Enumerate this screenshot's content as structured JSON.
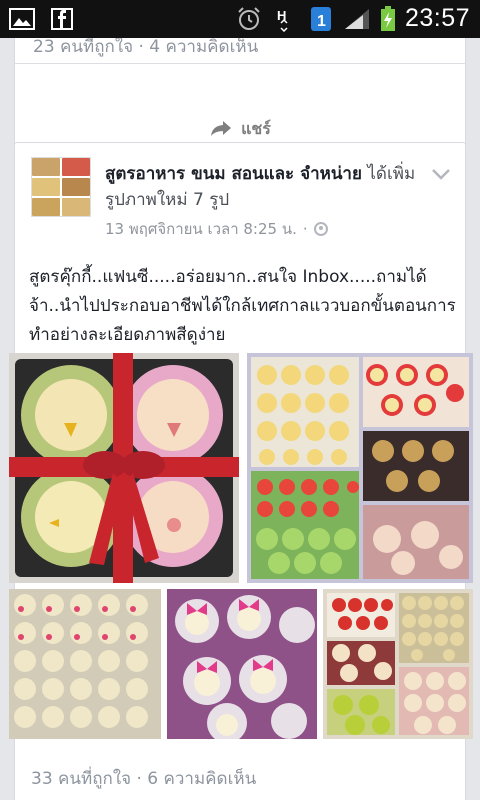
{
  "status_bar": {
    "time": "23:57",
    "network_badge": "1",
    "icons": [
      "image-notification-icon",
      "facebook-notification-icon",
      "alarm-icon",
      "hsdpa-icon",
      "sim-badge-icon",
      "signal-icon",
      "battery-charging-icon"
    ]
  },
  "previous_post": {
    "counts": "23 คนที่ถูกใจ · 4 ความคิดเห็น",
    "share_label": "แชร์"
  },
  "post": {
    "page_name": "สูตรอาหาร ขนม สอนและ จำหน่าย",
    "action": "ได้เพิ่มรูปภาพใหม่ 7 รูป",
    "timestamp": "13 พฤศจิกายน เวลา 8:25 น.",
    "separator": "·",
    "body": "สูตรคุ๊กกี้..แฟนซี.....อร่อยมาก..สนใจ Inbox.....ถามได้จ้า..นำไปประกอบอาชีพได้ใกล้เทศกาลแววบอกขั้นตอนการทำอย่างละเอียดภาพสีดูง่าย",
    "counts": "33 คนที่ถูกใจ · 6 ความคิดเห็น"
  },
  "colors": {
    "status_bar": "#111111",
    "feed_bg": "#e4e6ea",
    "card_bg": "#ffffff",
    "link": "#1d2129",
    "meta": "#90949c"
  }
}
